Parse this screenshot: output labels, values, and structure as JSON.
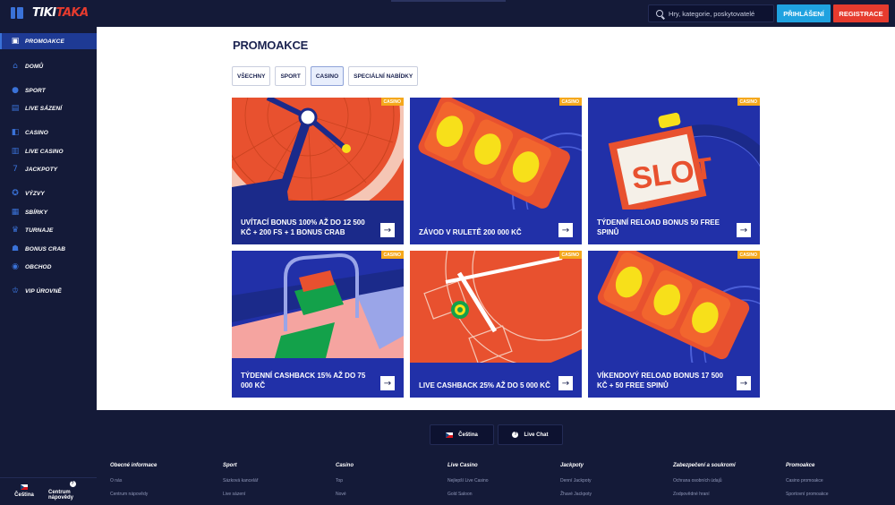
{
  "header": {
    "logo_part1": "TIKI",
    "logo_part2": "TAKA",
    "search_placeholder": "Hry, kategorie, poskytovatelé",
    "login_label": "PŘIHLÁŠENÍ",
    "register_label": "REGISTRACE"
  },
  "sidebar": {
    "items": [
      {
        "label": "PROMOAKCE",
        "icon": "gift-icon"
      },
      {
        "label": "DOMŮ",
        "icon": "home-icon"
      },
      {
        "label": "SPORT",
        "icon": "ball-icon"
      },
      {
        "label": "LIVE SÁZENÍ",
        "icon": "live-icon"
      },
      {
        "label": "CASINO",
        "icon": "cards-icon"
      },
      {
        "label": "LIVE CASINO",
        "icon": "live-casino-icon"
      },
      {
        "label": "JACKPOTY",
        "icon": "seven-icon"
      },
      {
        "label": "VÝZVY",
        "icon": "ribbon-icon"
      },
      {
        "label": "SBÍRKY",
        "icon": "collection-icon"
      },
      {
        "label": "TURNAJE",
        "icon": "trophy-icon"
      },
      {
        "label": "BONUS CRAB",
        "icon": "crab-icon"
      },
      {
        "label": "OBCHOD",
        "icon": "shop-icon"
      },
      {
        "label": "VIP ÚROVNĚ",
        "icon": "crown-icon"
      }
    ],
    "language": "Čeština",
    "help": "Centrum nápovědy"
  },
  "main": {
    "title": "PROMOAKCE",
    "tabs": [
      {
        "label": "VŠECHNY"
      },
      {
        "label": "SPORT"
      },
      {
        "label": "CASINO"
      },
      {
        "label": "SPECIÁLNÍ NABÍDKY"
      }
    ],
    "active_tab": "CASINO",
    "cards": [
      {
        "badge": "CASINO",
        "title": "UVÍTACÍ BONUS 100% AŽ DO 12 500 KČ + 200 FS + 1 BONUS CRAB"
      },
      {
        "badge": "CASINO",
        "title": "ZÁVOD V RULETĚ 200 000 KČ"
      },
      {
        "badge": "CASINO",
        "title": "TÝDENNÍ RELOAD BONUS 50 FREE SPINŮ",
        "art_text": "SLOT"
      },
      {
        "badge": "CASINO",
        "title": "TÝDENNÍ CASHBACK 15% AŽ DO 75 000 KČ"
      },
      {
        "badge": "CASINO",
        "title": "LIVE CASHBACK 25% AŽ DO 5 000 KČ"
      },
      {
        "badge": "CASINO",
        "title": "VÍKENDOVÝ RELOAD BONUS 17 500 KČ + 50 FREE SPINŮ"
      }
    ],
    "arrow_glyph": "→"
  },
  "footer": {
    "language_button": "Čeština",
    "chat_button": "Live Chat",
    "columns": [
      {
        "heading": "Obecné informace",
        "links": [
          "O nás",
          "Centrum nápovědy"
        ]
      },
      {
        "heading": "Sport",
        "links": [
          "Sázková kancelář",
          "Live sázení"
        ]
      },
      {
        "heading": "Casino",
        "links": [
          "Top",
          "Nové"
        ]
      },
      {
        "heading": "Live Casino",
        "links": [
          "Nejlepší Live Casino",
          "Gold Saloon"
        ]
      },
      {
        "heading": "Jackpoty",
        "links": [
          "Denní Jackpoty",
          "Žhavé Jackpoty"
        ]
      },
      {
        "heading": "Zabezpečení a soukromí",
        "links": [
          "Ochrana osobních údajů",
          "Zodpovědné hraní"
        ]
      },
      {
        "heading": "Promoakce",
        "links": [
          "Casino promoakce",
          "Sportovní promoakce"
        ]
      }
    ]
  },
  "colors": {
    "navy": "#141a38",
    "accent_blue": "#3a72d8",
    "brand_red": "#e63b2e",
    "login_blue": "#1fa2e0",
    "badge_orange": "#f5a81c"
  }
}
